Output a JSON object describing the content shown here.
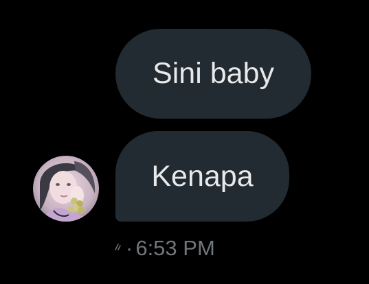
{
  "conversation": {
    "messages": [
      {
        "text": "Sini baby"
      },
      {
        "text": "Kenapa"
      }
    ],
    "timestamp": "6:53 PM",
    "separator": "·",
    "avatar": {
      "icon": "user-avatar-photo"
    }
  },
  "colors": {
    "background": "#000000",
    "bubble": "#222b31",
    "text": "#e7e9ea",
    "meta": "#71767b"
  }
}
